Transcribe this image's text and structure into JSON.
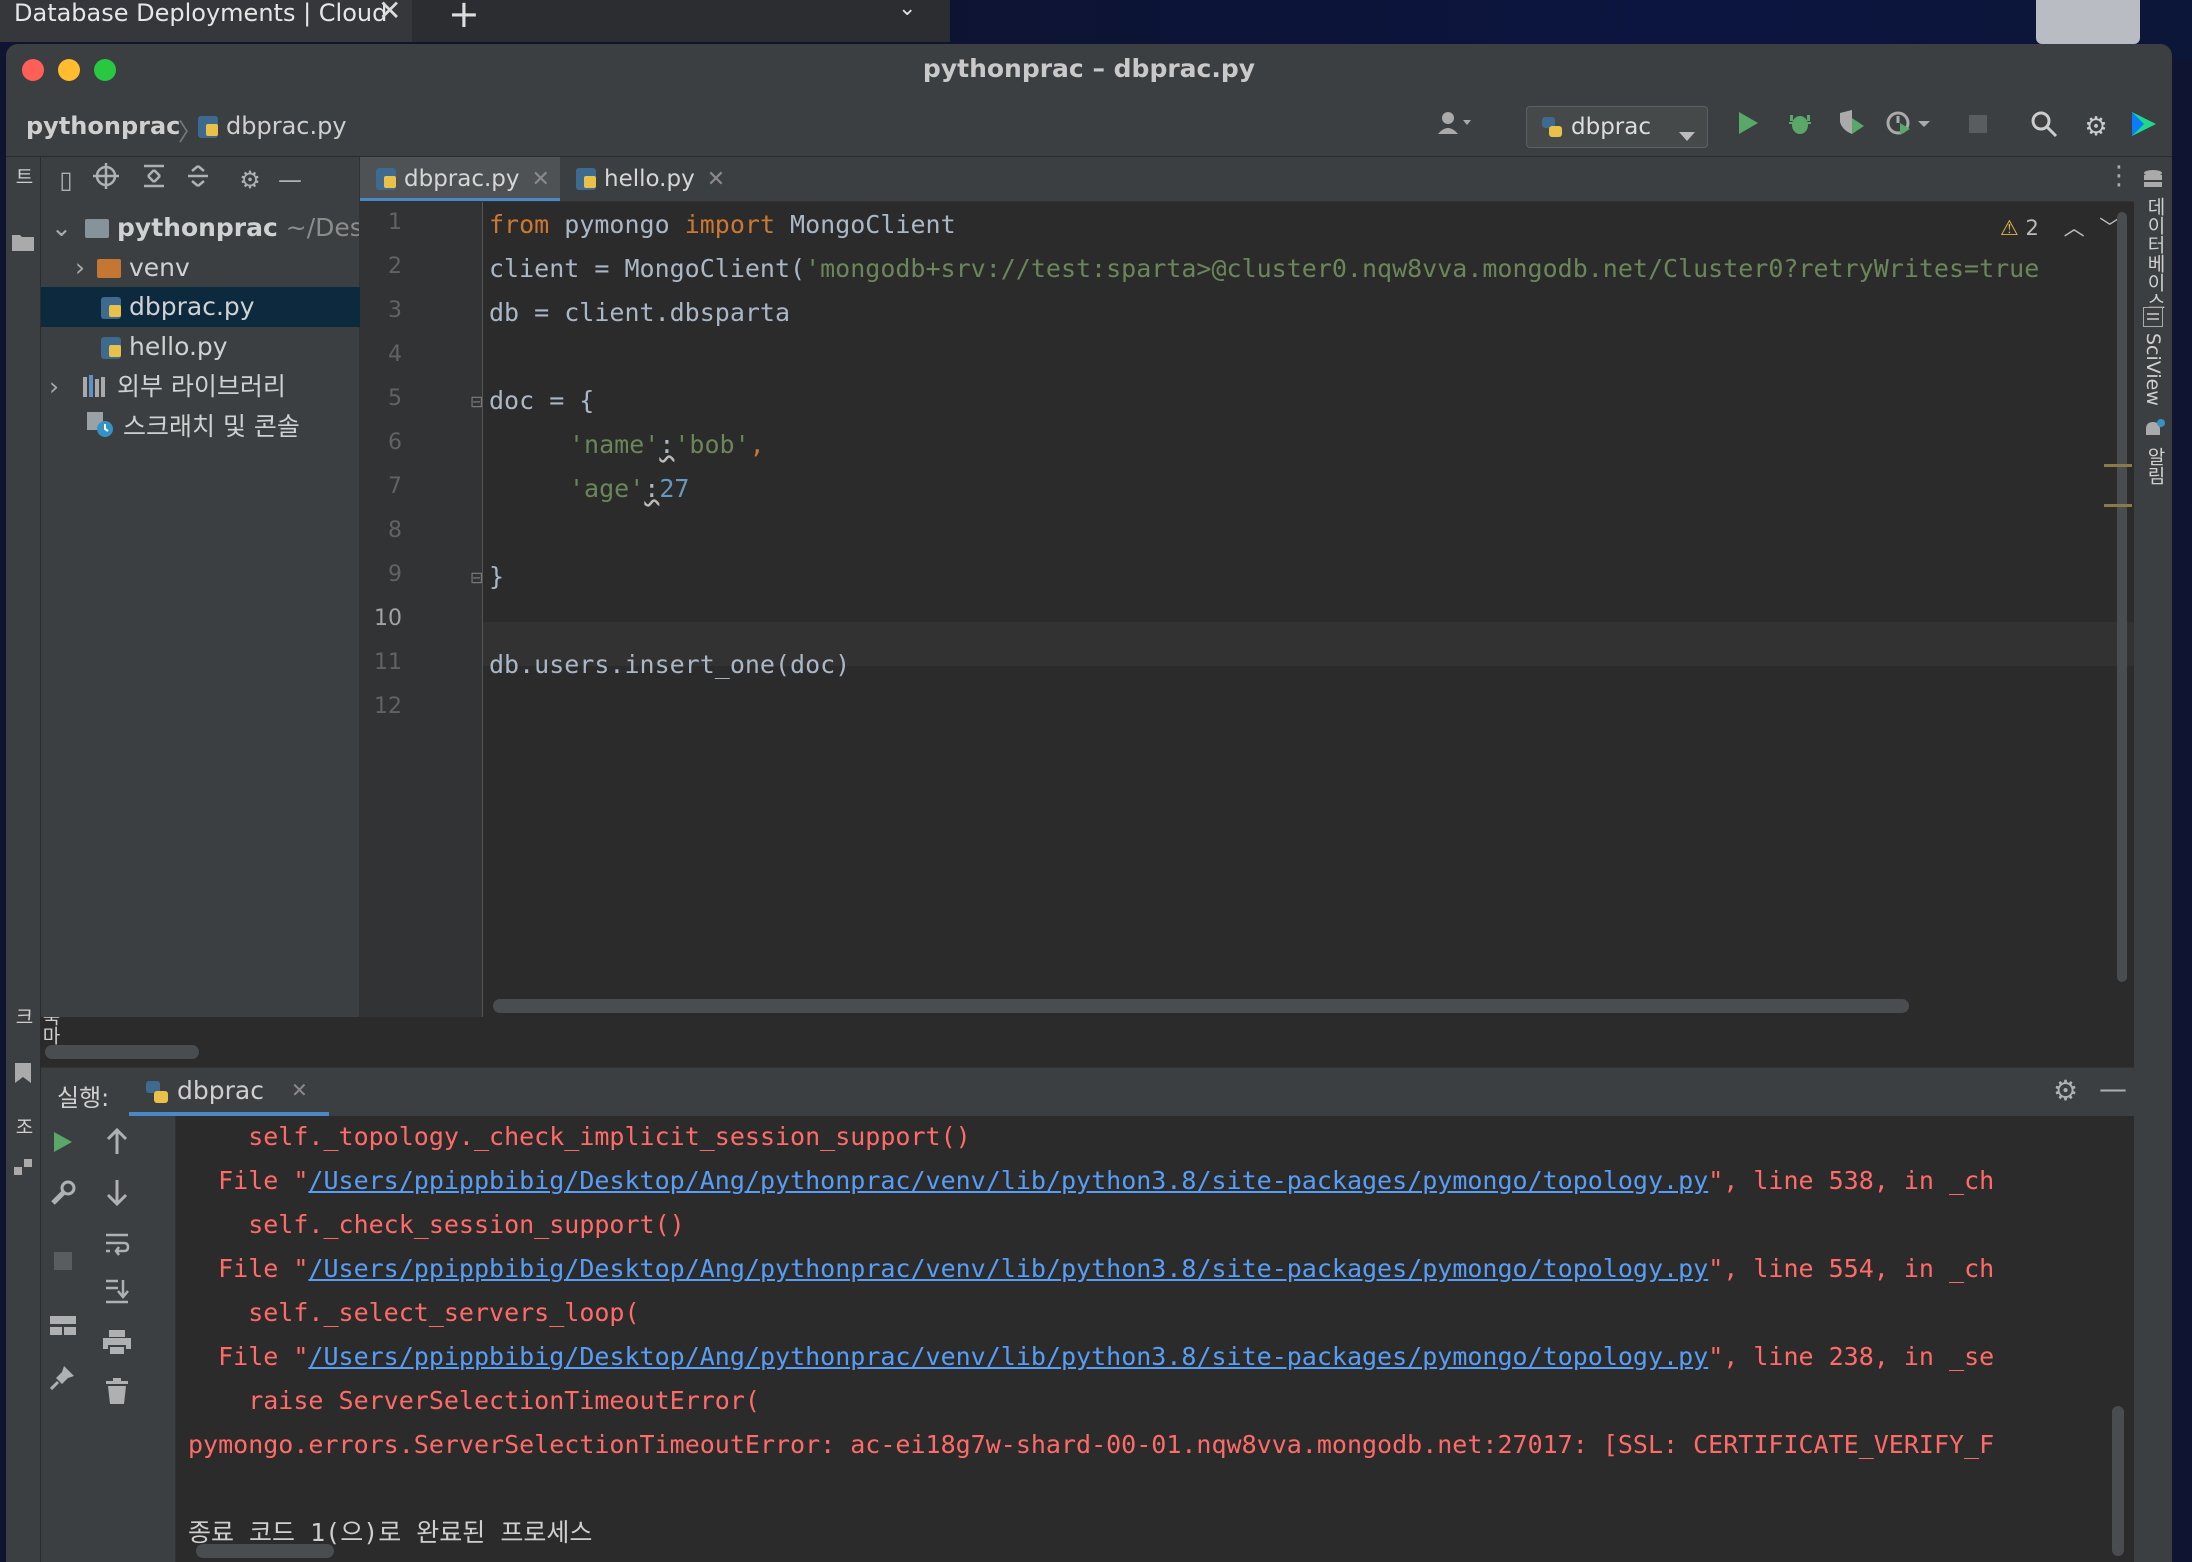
{
  "browser": {
    "tab_title": "Database Deployments | Cloud",
    "close_glyph": "✕",
    "new_tab_glyph": "+",
    "menu_glyph": "⌄"
  },
  "window": {
    "title": "pythonprac – dbprac.py"
  },
  "breadcrumb": {
    "project": "pythonprac",
    "file": "dbprac.py"
  },
  "toolbar": {
    "run_config": "dbprac"
  },
  "stripes": {
    "left_top": "프로젝트",
    "left_bookmarks": "북마크",
    "left_structure": "구조",
    "right_database": "데이터베이스",
    "right_sciview": "SciView",
    "right_notifications": "알림"
  },
  "project_tree": {
    "root": "pythonprac",
    "root_path": "~/Des",
    "items": [
      {
        "label": "venv"
      },
      {
        "label": "dbprac.py"
      },
      {
        "label": "hello.py"
      },
      {
        "label": "외부 라이브러리"
      },
      {
        "label": "스크래치 및 콘솔"
      }
    ]
  },
  "editor": {
    "tabs": [
      {
        "label": "dbprac.py",
        "active": true
      },
      {
        "label": "hello.py",
        "active": false
      }
    ],
    "warning_count": "2",
    "line_numbers": [
      "1",
      "2",
      "3",
      "4",
      "5",
      "6",
      "7",
      "8",
      "9",
      "10",
      "11",
      "12"
    ],
    "lines": {
      "l1_kw1": "from",
      "l1_mod": " pymongo ",
      "l1_kw2": "import",
      "l1_cls": " MongoClient",
      "l2_a": "client = MongoClient(",
      "l2_str": "'mongodb+srv://test:sparta>@cluster0.nqw8vva.mongodb.net/Cluster0?retryWrites=true",
      "l3": "db = client.dbsparta",
      "l5": "doc = {",
      "l6_k": "'name'",
      "l6_c": ":",
      "l6_v": "'bob'",
      "l6_e": ",",
      "l7_k": "'age'",
      "l7_c": ":",
      "l7_v": "27",
      "l9": "}",
      "l11": "db.users.insert_one(doc)"
    }
  },
  "run": {
    "label": "실행:",
    "tab": "dbprac",
    "console": {
      "c1": "    self._topology._check_implicit_session_support()",
      "file_prefix": "  File \"",
      "path": "/Users/ppippbibig/Desktop/Ang/pythonprac/venv/lib/python3.8/site-packages/pymongo/topology.py",
      "c2_suffix": "\", line 538, in _ch",
      "c3": "    self._check_session_support()",
      "c4_suffix": "\", line 554, in _ch",
      "c5": "    self._select_servers_loop(",
      "c6_suffix": "\", line 238, in _se",
      "c7": "    raise ServerSelectionTimeoutError(",
      "c8": "pymongo.errors.ServerSelectionTimeoutError: ac-ei18g7w-shard-00-01.nqw8vva.mongodb.net:27017: [SSL: CERTIFICATE_VERIFY_F",
      "exit": "종료 코드 1(으)로 완료된 프로세스"
    }
  },
  "colors": {
    "keyword": "#cc7832",
    "string": "#6a8759",
    "number": "#6897bb",
    "error": "#ff6b68",
    "link": "#589df6"
  },
  "icons": [
    "search-icon",
    "gear-icon",
    "run-icon",
    "debug-icon",
    "stop-icon",
    "user-icon",
    "chevron-down-icon",
    "folder-icon",
    "python-file-icon",
    "close-icon",
    "minimize-icon",
    "rerun-icon",
    "wrench-icon",
    "arrow-up-icon",
    "arrow-down-icon",
    "wrap-icon",
    "scroll-end-icon",
    "print-icon",
    "trash-icon",
    "pin-icon",
    "layout-icon",
    "database-icon",
    "sciview-icon",
    "bell-icon",
    "warning-icon",
    "more-icon"
  ]
}
